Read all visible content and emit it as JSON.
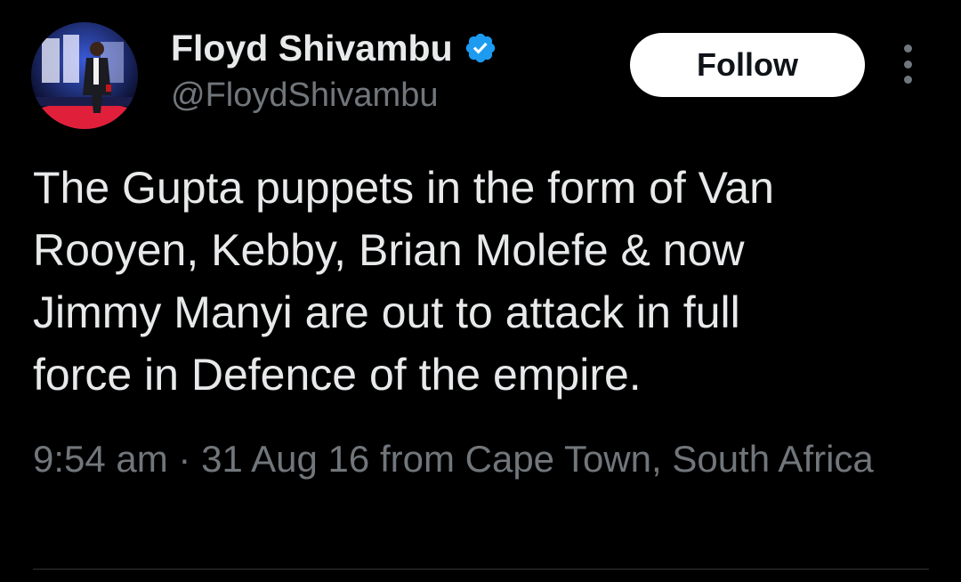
{
  "tweet": {
    "author": {
      "display_name": "Floyd Shivambu",
      "handle": "@FloydShivambu",
      "verified": true,
      "verified_color": "#1d9bf0",
      "avatar_icon": "profile-photo"
    },
    "follow_label": "Follow",
    "more_icon": "more-vertical-icon",
    "text": "The Gupta puppets in the form of Van\nRooyen, Kebby, Brian Molefe & now\nJimmy Manyi are out to attack in full\nforce in Defence of the empire.",
    "time": "9:54 am",
    "separator": " · ",
    "date": "31 Aug 16",
    "source_prefix": " from ",
    "location": "Cape Town, South Africa"
  },
  "colors": {
    "background": "#000000",
    "primary_text": "#e7e9ea",
    "secondary_text": "#71767b",
    "follow_bg": "#ffffff",
    "follow_text": "#0f1419"
  }
}
